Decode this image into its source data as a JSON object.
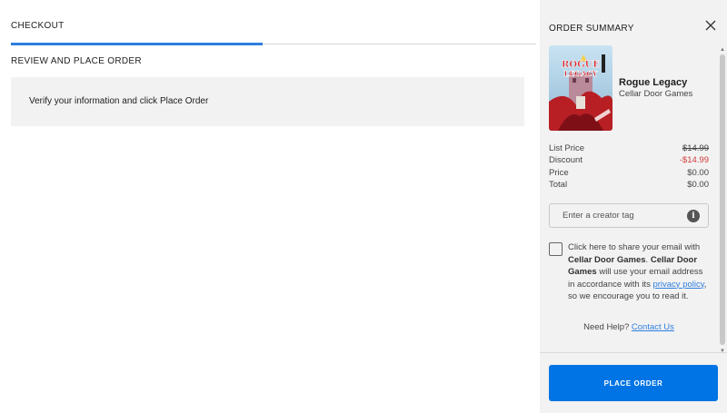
{
  "checkout": {
    "tab_label": "CHECKOUT",
    "section_title": "REVIEW AND PLACE ORDER",
    "notice": "Verify your information and click Place Order"
  },
  "summary": {
    "title": "ORDER SUMMARY",
    "close_icon": "close-icon",
    "game": {
      "title": "Rogue Legacy",
      "developer": "Cellar Door Games",
      "cover_text": "ROGUE LEGACY"
    },
    "prices": [
      {
        "label": "List Price",
        "value": "$14.99",
        "style": "strike"
      },
      {
        "label": "Discount",
        "value": "-$14.99",
        "style": "red"
      },
      {
        "label": "Price",
        "value": "$0.00",
        "style": ""
      },
      {
        "label": "Total",
        "value": "$0.00",
        "style": ""
      }
    ],
    "creator_tag": {
      "placeholder": "Enter a creator tag",
      "value": "",
      "info_icon": "info-icon"
    },
    "consent": {
      "text_1": "Click here to share your email with ",
      "bold_1": "Cellar Door Games",
      "text_2": ". ",
      "bold_2": "Cellar Door Games",
      "text_3": " will use your email address in accordance with its ",
      "link": "privacy policy",
      "text_4": ", so we encourage you to read it.",
      "checked": false
    },
    "help": {
      "text": "Need Help?",
      "link": "Contact Us"
    },
    "place_order": "PLACE ORDER",
    "colors": {
      "accent": "#0074e4",
      "discount": "#d33b3b",
      "panel_bg": "#f2f2f2"
    }
  }
}
